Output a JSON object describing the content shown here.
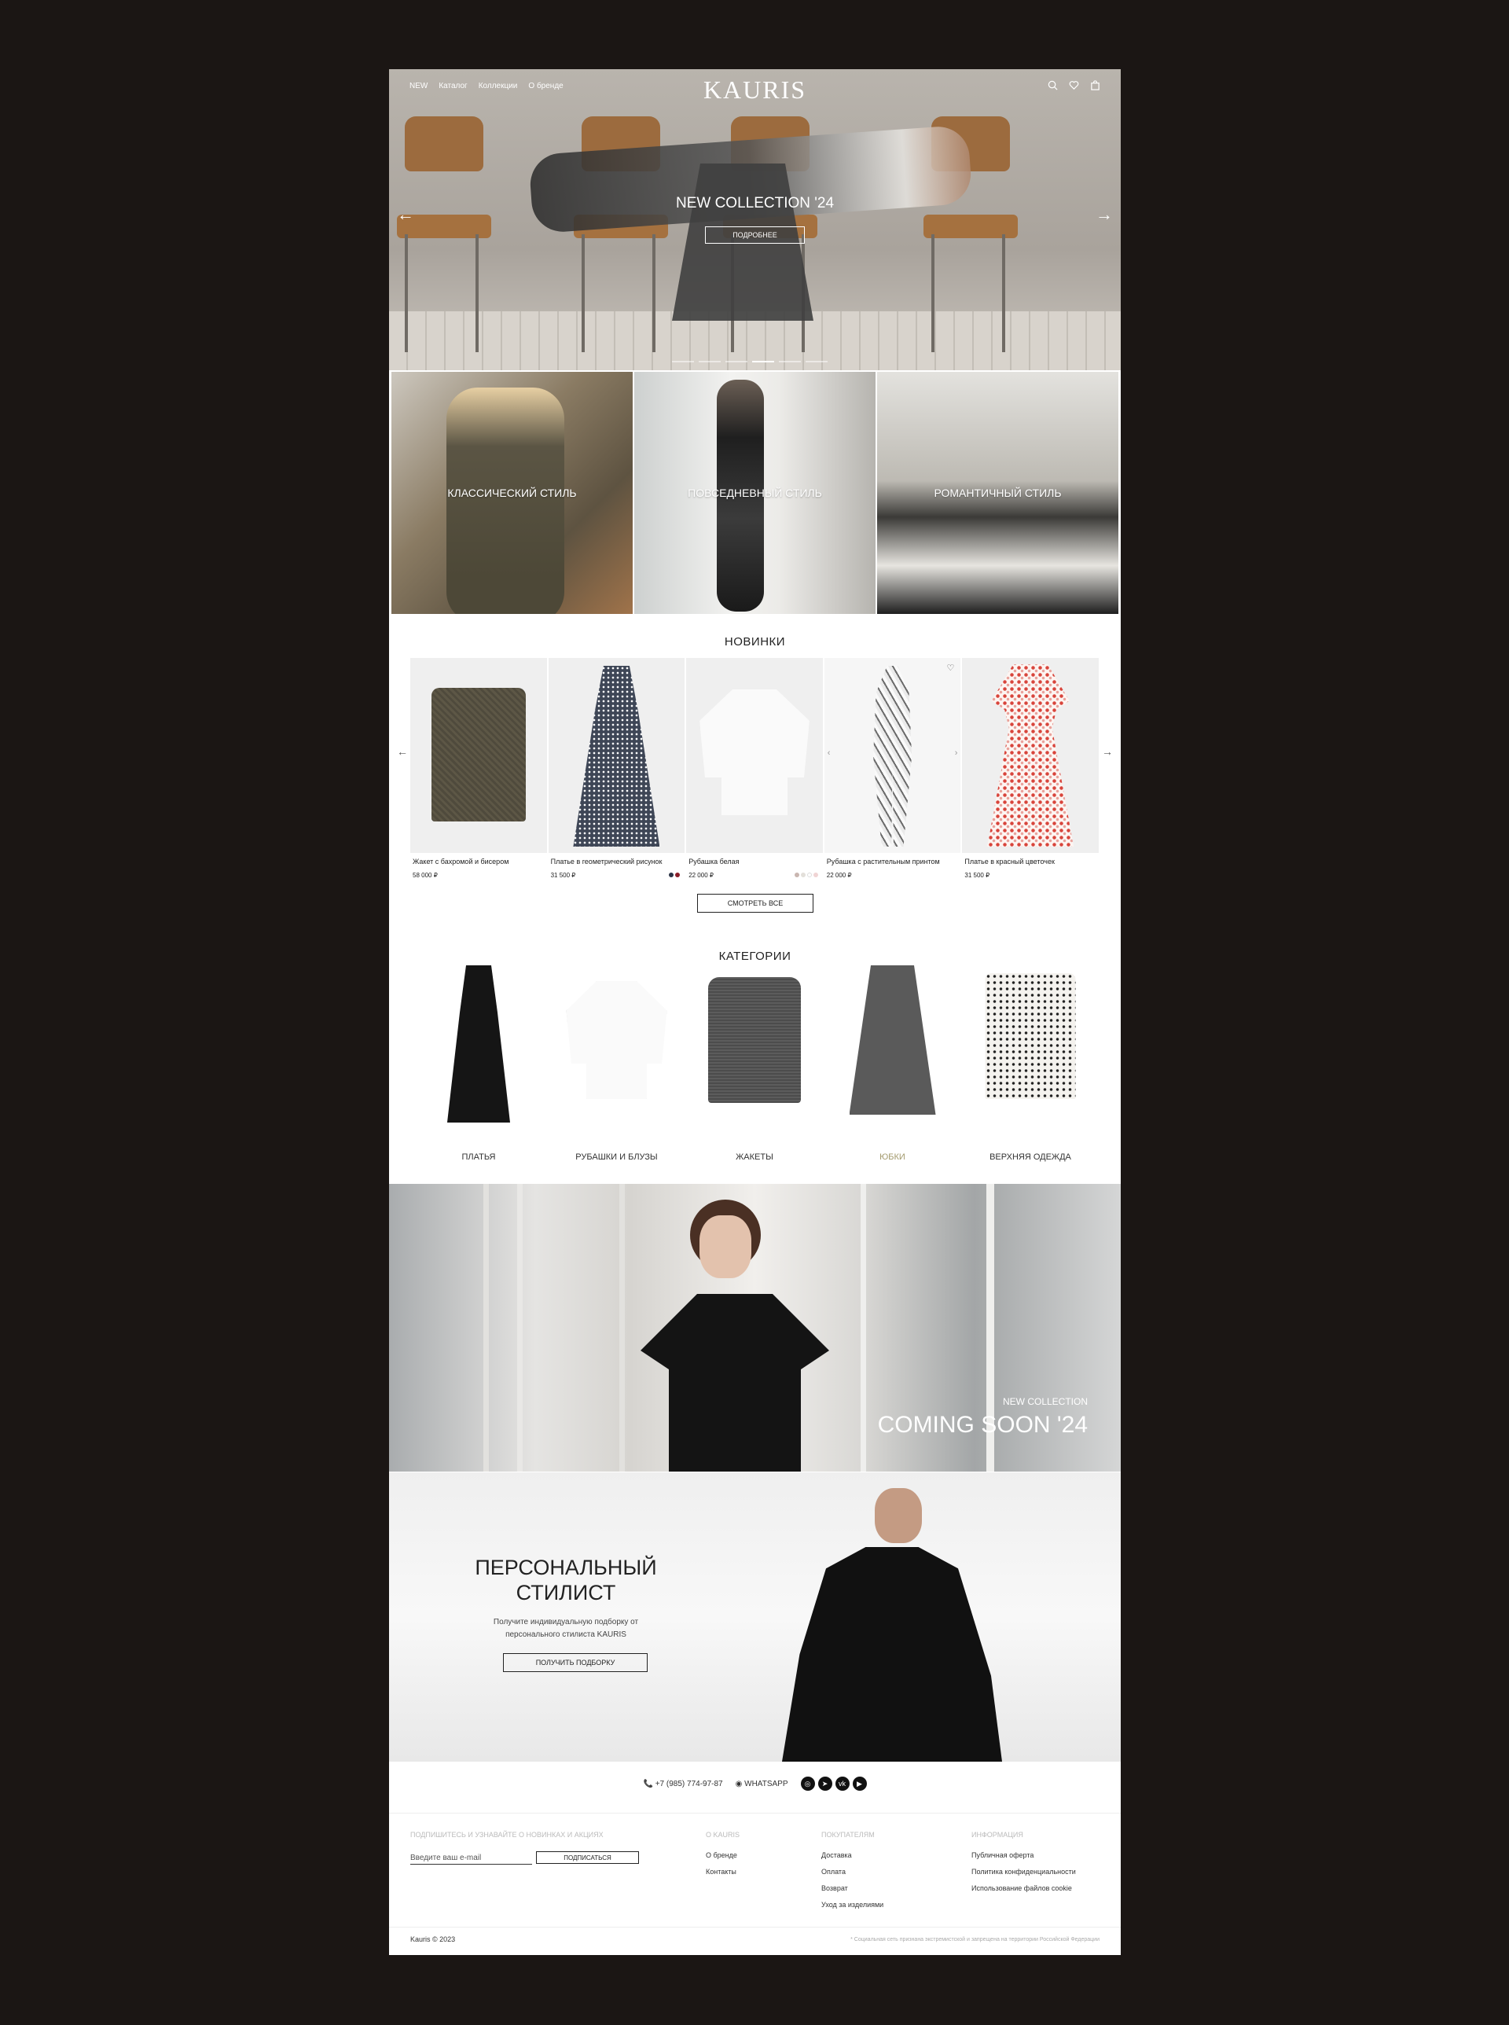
{
  "header": {
    "nav": [
      "NEW",
      "Каталог",
      "Коллекции",
      "О бренде"
    ],
    "logo": "KAURIS",
    "icons": [
      "search-icon",
      "heart-icon",
      "bag-icon"
    ]
  },
  "hero": {
    "title": "NEW COLLECTION '24",
    "button": "ПОДРОБНЕЕ",
    "prev": "←",
    "next": "→"
  },
  "styles": [
    "КЛАССИЧЕСКИЙ СТИЛЬ",
    "ПОВСЕДНЕВНЫЙ СТИЛЬ",
    "РОМАНТИЧНЫЙ СТИЛЬ"
  ],
  "new_arrivals": {
    "title": "НОВИНКИ",
    "products": [
      {
        "name": "Жакет с бахромой и бисером",
        "price": "58 000 ₽"
      },
      {
        "name": "Платье в геометрический рисунок",
        "price": "31 500 ₽"
      },
      {
        "name": "Рубашка белая",
        "price": "22 000 ₽"
      },
      {
        "name": "Рубашка с растительным принтом",
        "price": "22 000 ₽"
      },
      {
        "name": "Платье в красный цветочек",
        "price": "31 500 ₽"
      }
    ],
    "view_all": "СМОТРЕТЬ ВСЕ"
  },
  "categories": {
    "title": "КАТЕГОРИИ",
    "items": [
      "ПЛАТЬЯ",
      "РУБАШКИ И БЛУЗЫ",
      "ЖАКЕТЫ",
      "ЮБКИ",
      "ВЕРХНЯЯ ОДЕЖДА"
    ]
  },
  "banner": {
    "subtitle": "NEW COLLECTION",
    "title": "COMING SOON '24"
  },
  "stylist": {
    "title": "ПЕРСОНАЛЬНЫЙ СТИЛИСТ",
    "text": "Получите индивидуальную подборку от персонального стилиста KAURIS",
    "button": "ПОЛУЧИТЬ ПОДБОРКУ"
  },
  "contacts": {
    "phone": "+7 (985) 774-97-87",
    "whatsapp": "WHATSAPP",
    "socials": [
      "instagram-icon",
      "telegram-icon",
      "vk-icon",
      "youtube-icon"
    ]
  },
  "footer": {
    "subscribe_heading": "ПОДПИШИТЕСЬ И УЗНАВАЙТЕ О НОВИНКАХ И АКЦИЯХ",
    "email_placeholder": "Введите ваш e-mail",
    "subscribe_button": "ПОДПИСАТЬСЯ",
    "about": {
      "heading": "О KAURIS",
      "links": [
        "О бренде",
        "Контакты"
      ]
    },
    "buyers": {
      "heading": "ПОКУПАТЕЛЯМ",
      "links": [
        "Доставка",
        "Оплата",
        "Возврат",
        "Уход за изделиями"
      ]
    },
    "info": {
      "heading": "ИНФОРМАЦИЯ",
      "links": [
        "Публичная оферта",
        "Политика конфиденциальности",
        "Использование файлов cookie"
      ]
    },
    "copyright": "Kauris © 2023",
    "disclaimer": "* Социальная сеть признана экстремистской и запрещена на территории Российской Федерации"
  },
  "colors": {
    "background": "#1b1614",
    "accent": "#a39a6d",
    "text": "#222222"
  }
}
